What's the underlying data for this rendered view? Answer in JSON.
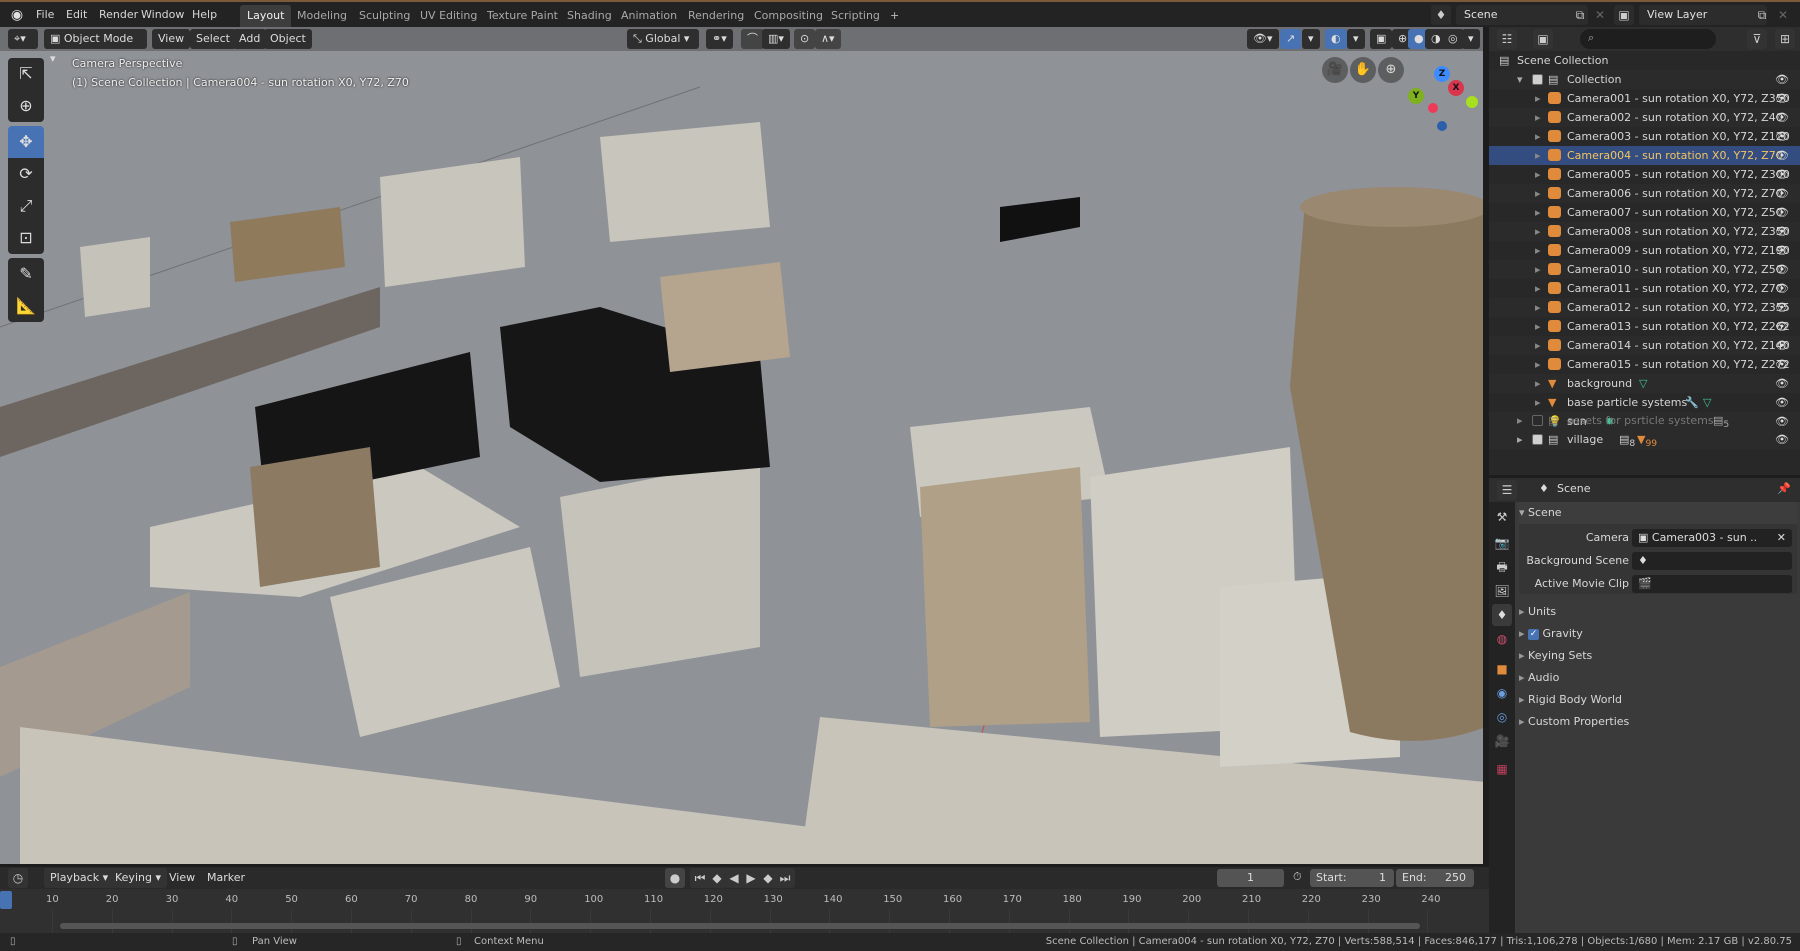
{
  "app": {
    "logo_icon": "blender-logo-icon"
  },
  "menu": [
    "File",
    "Edit",
    "Render",
    "Window",
    "Help"
  ],
  "workspaces": [
    {
      "label": "Layout",
      "active": true
    },
    {
      "label": "Modeling"
    },
    {
      "label": "Sculpting"
    },
    {
      "label": "UV Editing"
    },
    {
      "label": "Texture Paint"
    },
    {
      "label": "Shading"
    },
    {
      "label": "Animation"
    },
    {
      "label": "Rendering"
    },
    {
      "label": "Compositing"
    },
    {
      "label": "Scripting"
    }
  ],
  "add_workspace": "+",
  "scene_selector": {
    "value": "Scene"
  },
  "view_layer_selector": {
    "value": "View Layer"
  },
  "viewport": {
    "mode": "Object Mode",
    "menus": [
      "View",
      "Select",
      "Add",
      "Object"
    ],
    "transform_orientation": "Global",
    "overlay_title": "Camera Perspective",
    "overlay_subtitle": "(1) Scene Collection | Camera004 - sun rotation X0, Y72, Z70",
    "tools": [
      "select-box",
      "cursor",
      "move",
      "rotate",
      "scale",
      "transform",
      "annotate",
      "measure"
    ],
    "active_tool": "move",
    "gizmo_axes": {
      "z": "Z",
      "x": "X",
      "y": "Y"
    },
    "colors": {
      "ground": "#8e9195",
      "building": "#c9c6bd",
      "adobe": "#8f7a5c",
      "dark": "#141414",
      "tower": "#8c7a60"
    }
  },
  "outliner": {
    "root": "Scene Collection",
    "collection": "Collection",
    "items": [
      {
        "name": "Camera001 - sun rotation X0, Y72, Z350",
        "type": "camera"
      },
      {
        "name": "Camera002 - sun rotation X0, Y72, Z40",
        "type": "camera"
      },
      {
        "name": "Camera003 - sun rotation X0, Y72, Z120",
        "type": "camera"
      },
      {
        "name": "Camera004 - sun rotation X0, Y72, Z70",
        "type": "camera",
        "selected": true
      },
      {
        "name": "Camera005 - sun rotation X0, Y72, Z300",
        "type": "camera"
      },
      {
        "name": "Camera006 - sun rotation X0, Y72, Z70",
        "type": "camera"
      },
      {
        "name": "Camera007 - sun rotation X0, Y72, Z50",
        "type": "camera"
      },
      {
        "name": "Camera008 - sun rotation X0, Y72, Z350",
        "type": "camera"
      },
      {
        "name": "Camera009 - sun rotation X0, Y72, Z190",
        "type": "camera"
      },
      {
        "name": "Camera010 - sun rotation X0, Y72, Z50",
        "type": "camera"
      },
      {
        "name": "Camera011 - sun rotation X0, Y72, Z70",
        "type": "camera"
      },
      {
        "name": "Camera012 - sun rotation X0, Y72, Z355",
        "type": "camera"
      },
      {
        "name": "Camera013 - sun rotation X0, Y72, Z262",
        "type": "camera"
      },
      {
        "name": "Camera014 - sun rotation X0, Y72, Z140",
        "type": "camera"
      },
      {
        "name": "Camera015 - sun rotation X0, Y72, Z272",
        "type": "camera"
      },
      {
        "name": "background",
        "type": "mesh"
      },
      {
        "name": "base particle systems",
        "type": "mesh"
      },
      {
        "name": "sun",
        "type": "light"
      }
    ],
    "other_collections": [
      {
        "name": "assets for psrticle systems",
        "enabled": false,
        "badge": "5"
      },
      {
        "name": "village",
        "enabled": true,
        "badge_collections": "8",
        "badge_meshes": "99"
      }
    ]
  },
  "properties": {
    "context": "Scene",
    "panel_title": "Scene",
    "fields": [
      {
        "label": "Camera",
        "value": "Camera003 - sun .."
      },
      {
        "label": "Background Scene",
        "value": ""
      },
      {
        "label": "Active Movie Clip",
        "value": ""
      }
    ],
    "subpanels": [
      "Units",
      "Gravity",
      "Keying Sets",
      "Audio",
      "Rigid Body World",
      "Custom Properties"
    ],
    "gravity_checked": true
  },
  "timeline": {
    "menus": [
      "Playback",
      "Keying",
      "View",
      "Marker"
    ],
    "current_frame": "1",
    "start_label": "Start:",
    "start": "1",
    "end_label": "End:",
    "end": "250",
    "ticks": [
      "10",
      "20",
      "30",
      "40",
      "50",
      "60",
      "70",
      "80",
      "90",
      "100",
      "110",
      "120",
      "130",
      "140",
      "150",
      "160",
      "170",
      "180",
      "190",
      "200",
      "210",
      "220",
      "230",
      "240"
    ]
  },
  "status": {
    "left_hint": "",
    "middle_hint": "Pan View",
    "right_hint": "Context Menu",
    "stats": "Scene Collection | Camera004 - sun rotation X0, Y72, Z70 | Verts:588,514 | Faces:846,177 | Tris:1,106,278 | Objects:1/680 | Mem: 2.17 GB | v2.80.75"
  }
}
